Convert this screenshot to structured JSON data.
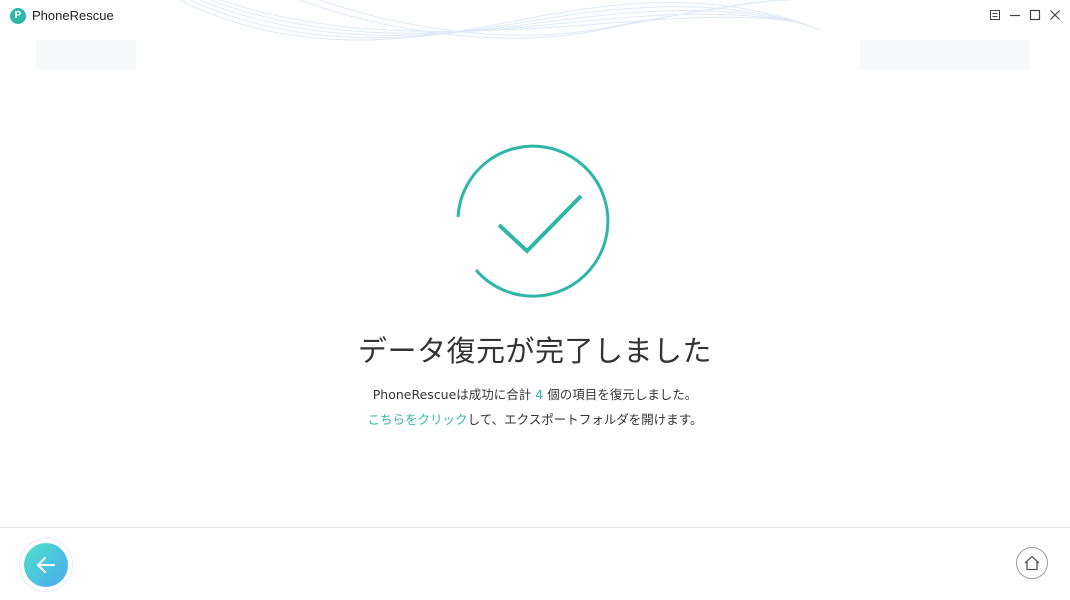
{
  "window": {
    "title": "PhoneRescue",
    "logo_letter": "P"
  },
  "main": {
    "heading": "データ復元が完了しました",
    "summary_prefix": "PhoneRescueは成功に合計 ",
    "summary_count": "4",
    "summary_suffix": " 個の項目を復元しました。",
    "link_text": "こちらをクリック",
    "link_suffix": "して、エクスポートフォルダを開けます。"
  },
  "colors": {
    "accent": "#2fb6a8",
    "back_gradient_start": "#4fe0c8",
    "back_gradient_end": "#48aaf0"
  },
  "icons": {
    "success": "checkmark-circle-icon",
    "back": "arrow-left-icon",
    "home": "home-icon",
    "menu": "menu-icon",
    "minimize": "minimize-icon",
    "maximize": "maximize-icon",
    "close": "close-icon"
  }
}
